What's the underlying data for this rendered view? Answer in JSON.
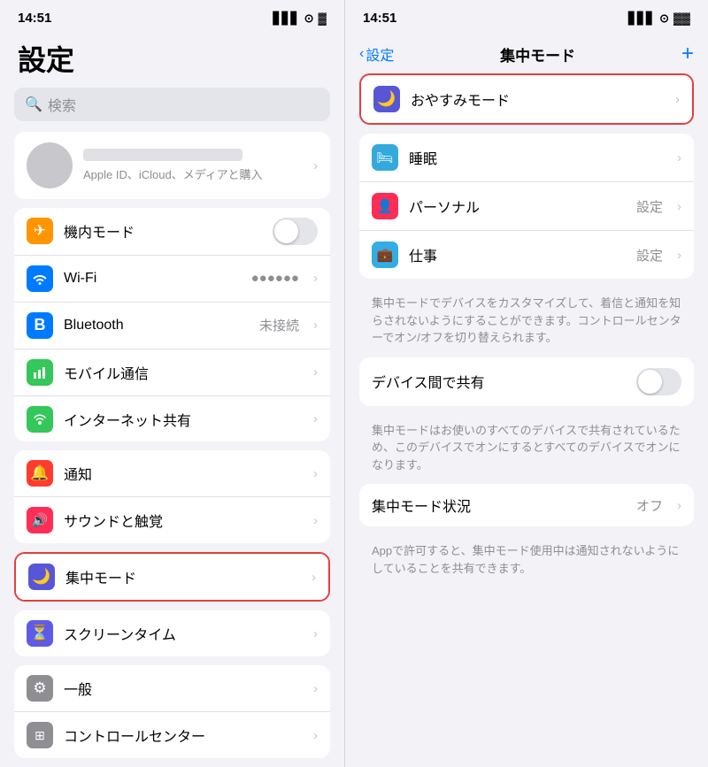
{
  "left": {
    "status_time": "14:51",
    "page_title": "設定",
    "search_placeholder": "検索",
    "appleid_label": "Apple ID、iCloud、メディアと購入",
    "sections": [
      {
        "rows": [
          {
            "icon": "airplane",
            "icon_class": "icon-orange",
            "label": "機内モード",
            "value": "",
            "has_toggle": true,
            "toggle_on": false,
            "has_chevron": false
          },
          {
            "icon": "wifi",
            "icon_class": "icon-blue",
            "label": "Wi-Fi",
            "value": "●●●●●●",
            "has_toggle": false,
            "has_chevron": true
          },
          {
            "icon": "bluetooth",
            "icon_class": "icon-blue2",
            "label": "Bluetooth",
            "value": "未接続",
            "has_toggle": false,
            "has_chevron": true
          },
          {
            "icon": "cellular",
            "icon_class": "icon-green",
            "label": "モバイル通信",
            "value": "",
            "has_toggle": false,
            "has_chevron": true
          },
          {
            "icon": "hotspot",
            "icon_class": "icon-green",
            "label": "インターネット共有",
            "value": "",
            "has_toggle": false,
            "has_chevron": true
          }
        ]
      },
      {
        "rows": [
          {
            "icon": "bell",
            "icon_class": "icon-red",
            "label": "通知",
            "value": "",
            "has_toggle": false,
            "has_chevron": true
          },
          {
            "icon": "sound",
            "icon_class": "icon-red2",
            "label": "サウンドと触覚",
            "value": "",
            "has_toggle": false,
            "has_chevron": true
          }
        ]
      },
      {
        "focus_highlight": true,
        "rows": [
          {
            "icon": "moon",
            "icon_class": "icon-purple",
            "label": "集中モード",
            "value": "",
            "has_toggle": false,
            "has_chevron": true
          }
        ]
      },
      {
        "rows": [
          {
            "icon": "hourglass",
            "icon_class": "icon-indigo",
            "label": "スクリーンタイム",
            "value": "",
            "has_toggle": false,
            "has_chevron": true
          }
        ]
      },
      {
        "rows": [
          {
            "icon": "gear",
            "icon_class": "icon-gray",
            "label": "一般",
            "value": "",
            "has_toggle": false,
            "has_chevron": true
          },
          {
            "icon": "control",
            "icon_class": "icon-gray",
            "label": "コントロールセンター",
            "value": "",
            "has_toggle": false,
            "has_chevron": true
          }
        ]
      }
    ]
  },
  "right": {
    "status_time": "14:51",
    "nav_back": "設定",
    "nav_title": "集中モード",
    "nav_add": "+",
    "focus_modes": [
      {
        "icon": "moon",
        "icon_class": "icon-dark-purple",
        "label": "おやすみモード",
        "value": "",
        "highlighted": true
      },
      {
        "icon": "bed",
        "icon_class": "icon-blue-sleep",
        "label": "睡眠",
        "value": ""
      },
      {
        "icon": "person",
        "icon_class": "icon-pink-personal",
        "label": "パーソナル",
        "value": "設定"
      },
      {
        "icon": "briefcase",
        "icon_class": "icon-teal-work",
        "label": "仕事",
        "value": "設定"
      }
    ],
    "description1": "集中モードでデバイスをカスタマイズして、着信と通知を知らされないようにすることができます。コントロールセンターでオン/オフを切り替えられます。",
    "share_label": "デバイス間で共有",
    "share_toggle_on": false,
    "description2": "集中モードはお使いのすべてのデバイスで共有されているため、このデバイスでオンにするとすべてのデバイスでオンになります。",
    "status_label": "集中モード状況",
    "status_value": "オフ",
    "description3": "Appで許可すると、集中モード使用中は通知されないようにしていることを共有できます。"
  },
  "icons": {
    "airplane": "✈",
    "wifi": "📶",
    "bluetooth": "⬡",
    "cellular": "📡",
    "hotspot": "🔗",
    "bell": "🔔",
    "sound": "🔊",
    "moon": "🌙",
    "hourglass": "⏳",
    "gear": "⚙",
    "control": "⊞",
    "bed": "🛏",
    "person": "👤",
    "briefcase": "💼"
  }
}
